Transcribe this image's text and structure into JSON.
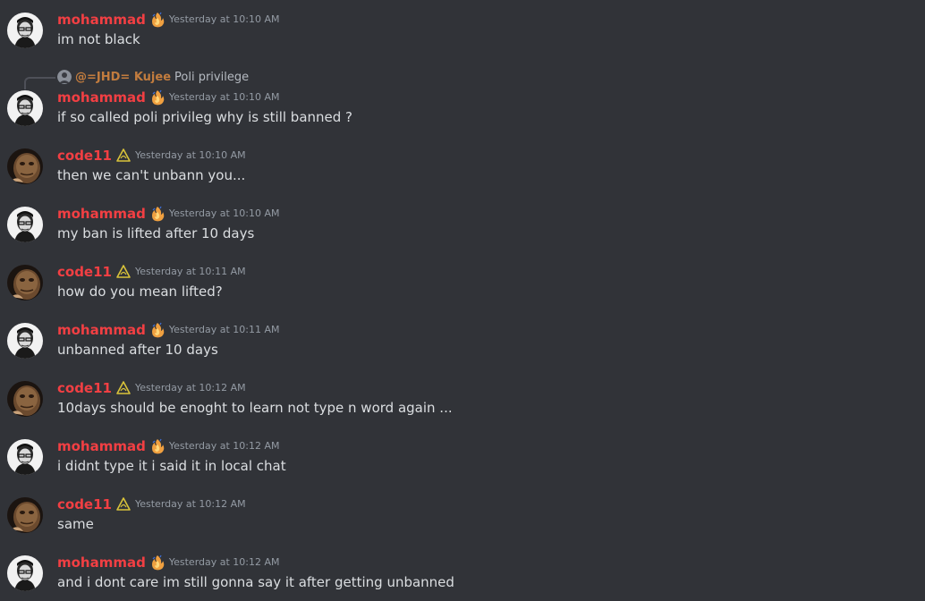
{
  "reply": {
    "author": "@=JHD= Kujee",
    "text": "Poli privilege"
  },
  "messages": [
    {
      "author": "mohammad",
      "badge": "flame-badge-icon",
      "time": "Yesterday at 10:10 AM",
      "text": "im not black"
    },
    {
      "author": "mohammad",
      "badge": "flame-badge-icon",
      "time": "Yesterday at 10:10 AM",
      "text": "if so called poli privileg why is still banned ?"
    },
    {
      "author": "code11",
      "badge": "leaf-badge-icon",
      "time": "Yesterday at 10:10 AM",
      "text": "then we can't unbann you..."
    },
    {
      "author": "mohammad",
      "badge": "flame-badge-icon",
      "time": "Yesterday at 10:10 AM",
      "text": "my ban is lifted after 10 days"
    },
    {
      "author": "code11",
      "badge": "leaf-badge-icon",
      "time": "Yesterday at 10:11 AM",
      "text": "how do you mean lifted?"
    },
    {
      "author": "mohammad",
      "badge": "flame-badge-icon",
      "time": "Yesterday at 10:11 AM",
      "text": "unbanned after 10 days"
    },
    {
      "author": "code11",
      "badge": "leaf-badge-icon",
      "time": "Yesterday at 10:12 AM",
      "text": "10days should be enoght to learn not type n word again ..."
    },
    {
      "author": "mohammad",
      "badge": "flame-badge-icon",
      "time": "Yesterday at 10:12 AM",
      "text": "i didnt type it i said it in local chat"
    },
    {
      "author": "code11",
      "badge": "leaf-badge-icon",
      "time": "Yesterday at 10:12 AM",
      "text": "same"
    },
    {
      "author": "mohammad",
      "badge": "flame-badge-icon",
      "time": "Yesterday at 10:12 AM",
      "text": "and i dont care im still gonna say it after getting unbanned"
    }
  ],
  "colors": {
    "background": "#313338",
    "author": "#f23f43",
    "timestamp": "#949ba4",
    "text": "#dbdee1",
    "reply_author": "#c27c3e"
  }
}
